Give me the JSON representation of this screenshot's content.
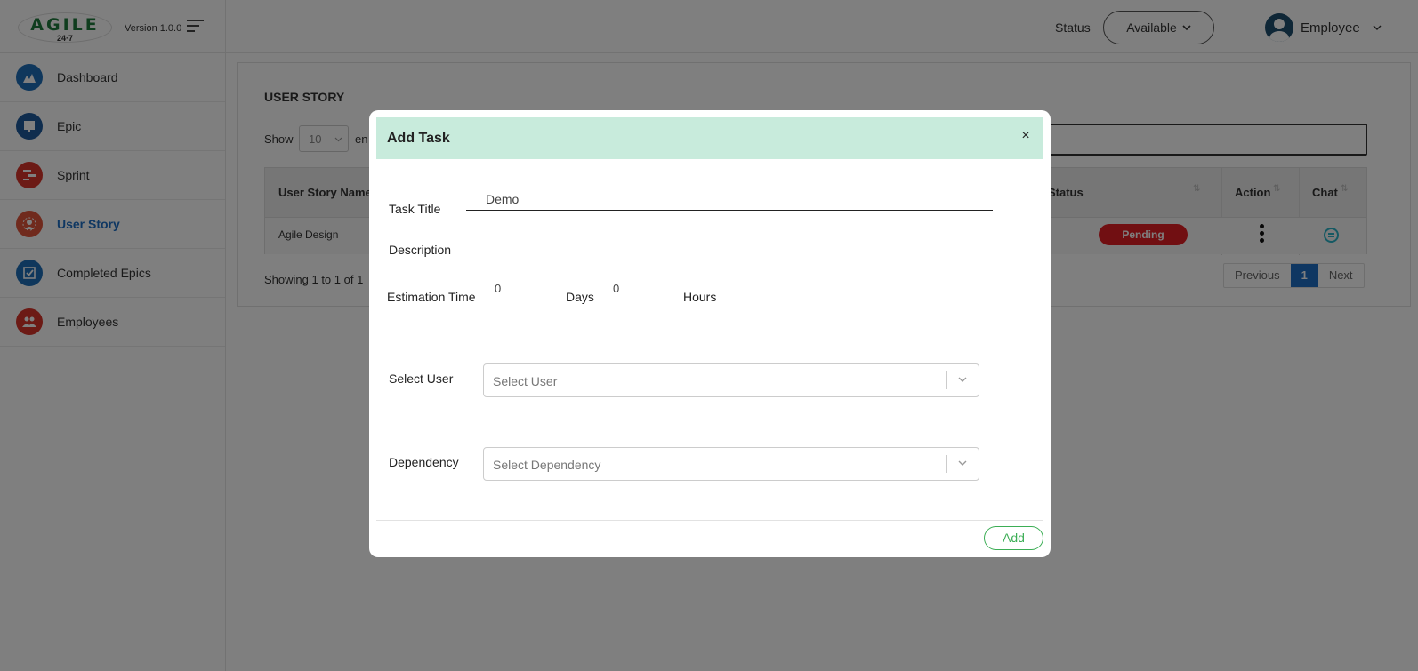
{
  "header": {
    "logo_text": "AGILE",
    "logo_sub": "24·7",
    "version": "Version 1.0.0",
    "status_label": "Status",
    "status_value": "Available",
    "user_name": "Employee"
  },
  "sidebar": {
    "items": [
      {
        "label": "Dashboard",
        "icon": "dashboard-icon",
        "color": "#1e6fb8"
      },
      {
        "label": "Epic",
        "icon": "epic-icon",
        "color": "#1e5a9c"
      },
      {
        "label": "Sprint",
        "icon": "sprint-icon",
        "color": "#d9342b"
      },
      {
        "label": "User Story",
        "icon": "user-story-icon",
        "color": "#e0553a",
        "active": true
      },
      {
        "label": "Completed Epics",
        "icon": "completed-epics-icon",
        "color": "#1e6fb8"
      },
      {
        "label": "Employees",
        "icon": "employees-icon",
        "color": "#d9342b"
      }
    ]
  },
  "main": {
    "title": "USER STORY",
    "show_label": "Show",
    "length_value": "10",
    "entries_label": "en",
    "columns": [
      "User Story Name",
      "Status",
      "Action",
      "Chat"
    ],
    "rows": [
      {
        "name": "Agile Design",
        "status": "Pending"
      }
    ],
    "info": "Showing 1 to 1 of 1",
    "pager": {
      "previous": "Previous",
      "current": "1",
      "next": "Next"
    }
  },
  "modal": {
    "title": "Add Task",
    "close": "×",
    "task_title_label": "Task Title",
    "task_title_value": "Demo",
    "description_label": "Description",
    "description_value": "",
    "estimation_label": "Estimation Time",
    "days_value": "0",
    "days_label": "Days",
    "hours_value": "0",
    "hours_label": "Hours",
    "select_user_label": "Select User",
    "select_user_placeholder": "Select User",
    "dependency_label": "Dependency",
    "dependency_placeholder": "Select Dependency",
    "add_button": "Add"
  },
  "colors": {
    "accent": "#1f6fc5",
    "modal_header": "#c8ebdc",
    "add_button": "#3cae55",
    "pending": "#e31e24",
    "overlay": "rgba(0,0,0,0.5)"
  }
}
